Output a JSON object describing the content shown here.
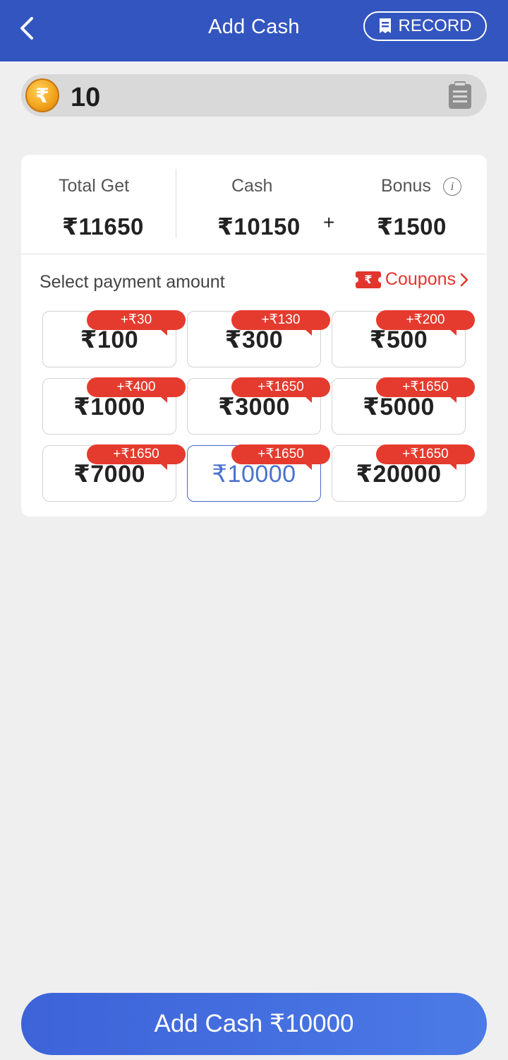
{
  "header": {
    "title": "Add Cash",
    "record_label": "RECORD",
    "background": "#3355bf"
  },
  "balance": {
    "currency_symbol": "₹",
    "value": "10"
  },
  "summary": {
    "total_label": "Total Get",
    "total_value": "₹11650",
    "cash_label": "Cash",
    "cash_value": "₹10150",
    "plus": "+",
    "bonus_label": "Bonus",
    "bonus_value": "₹1500",
    "info_glyph": "i"
  },
  "payment": {
    "select_label": "Select payment amount",
    "coupons_label": "Coupons",
    "coupon_icon_text": "₹",
    "amounts": [
      {
        "value": "₹100",
        "bonus": "+₹30",
        "selected": false
      },
      {
        "value": "₹300",
        "bonus": "+₹130",
        "selected": false
      },
      {
        "value": "₹500",
        "bonus": "+₹200",
        "selected": false
      },
      {
        "value": "₹1000",
        "bonus": "+₹400",
        "selected": false
      },
      {
        "value": "₹3000",
        "bonus": "+₹1650",
        "selected": false
      },
      {
        "value": "₹5000",
        "bonus": "+₹1650",
        "selected": false
      },
      {
        "value": "₹7000",
        "bonus": "+₹1650",
        "selected": false
      },
      {
        "value": "₹10000",
        "bonus": "+₹1650",
        "selected": true
      },
      {
        "value": "₹20000",
        "bonus": "+₹1650",
        "selected": false
      }
    ]
  },
  "footer": {
    "add_cash_label": "Add Cash ₹10000"
  },
  "colors": {
    "accent": "#3355bf",
    "bonus_tag": "#e53b2f",
    "selected_text": "#4a72cf"
  }
}
